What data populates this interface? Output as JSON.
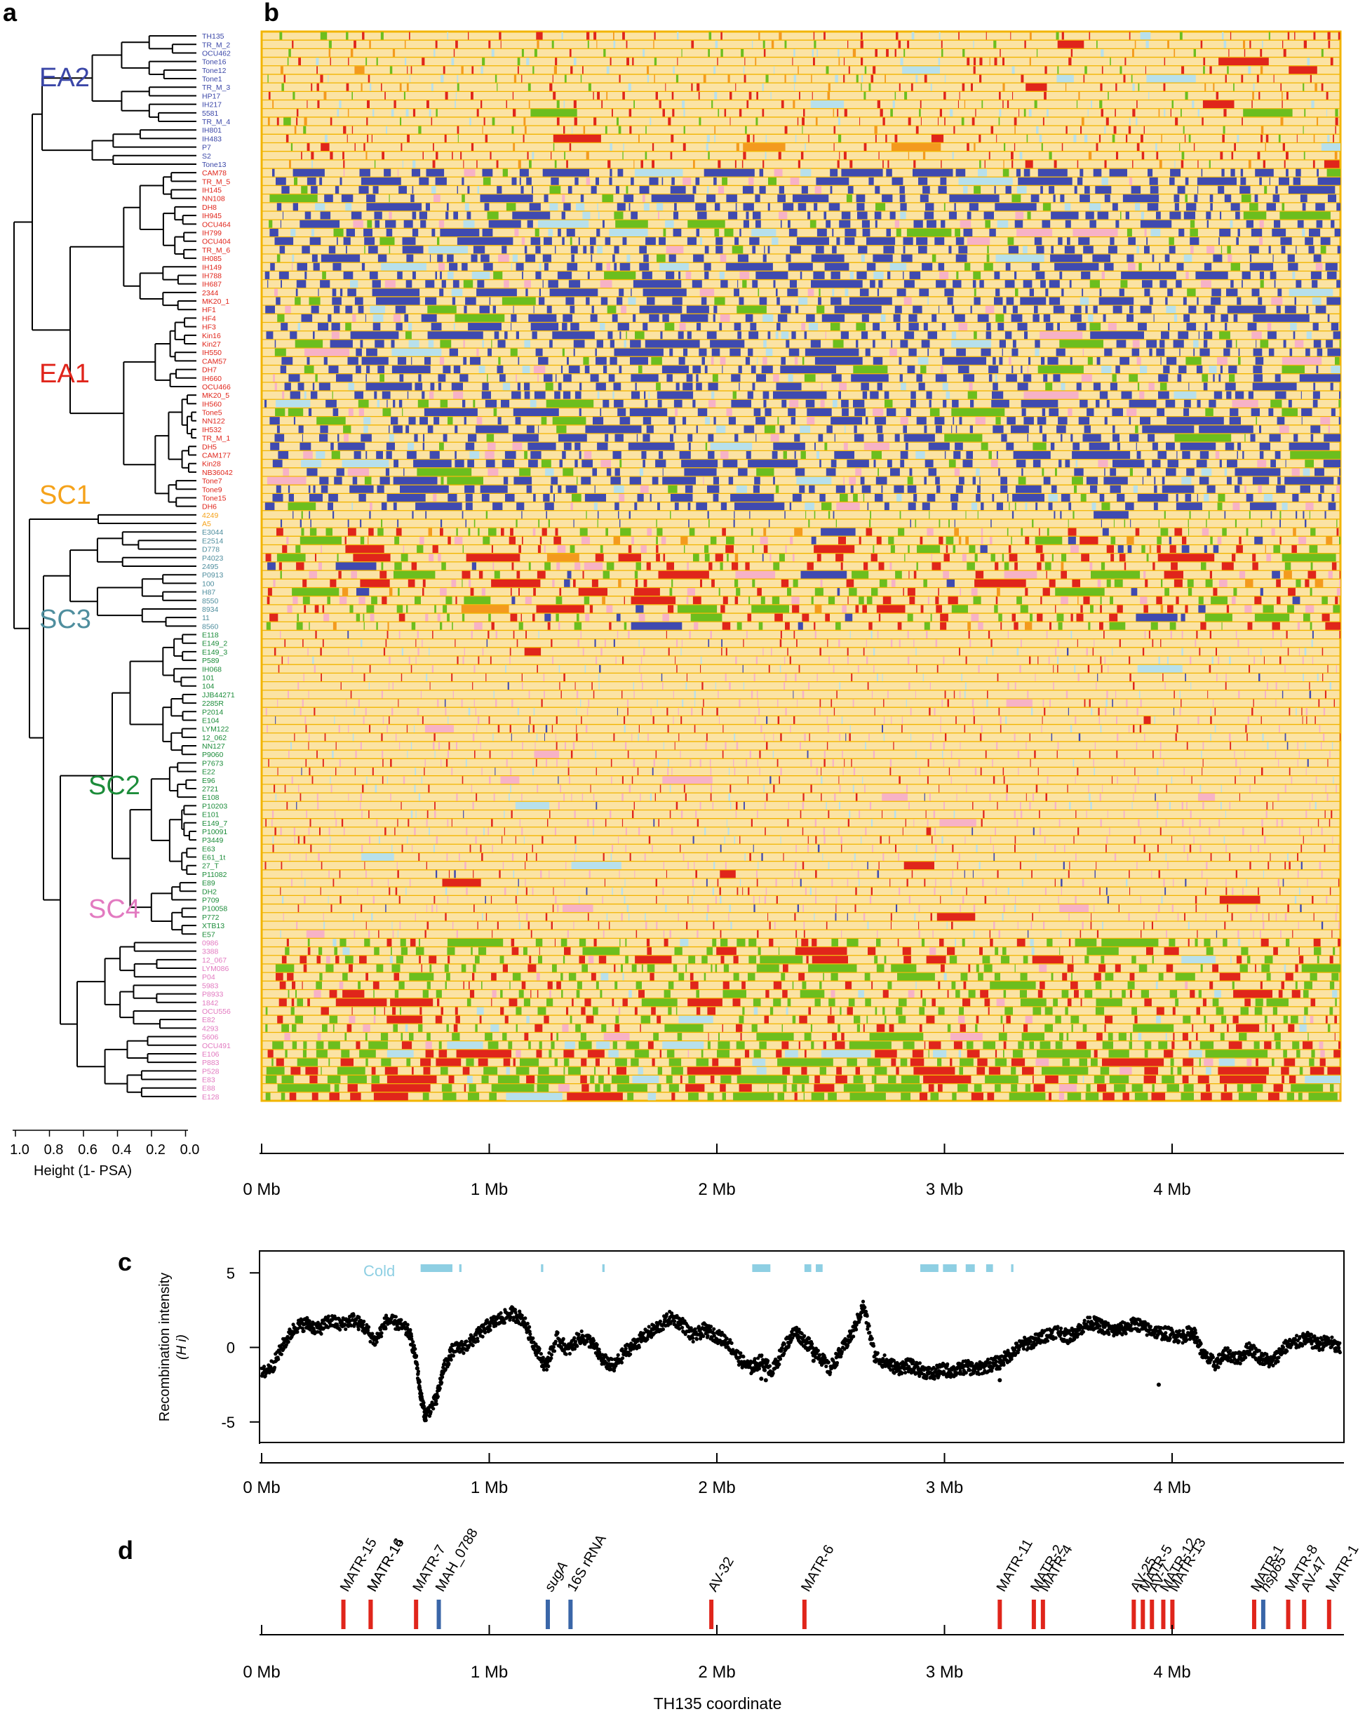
{
  "panels": {
    "a": {
      "letter": "a"
    },
    "b": {
      "letter": "b"
    },
    "c": {
      "letter": "c"
    },
    "d": {
      "letter": "d"
    }
  },
  "colors": {
    "EA2": "#3b47a8",
    "EA1": "#e0251b",
    "SC1": "#f5a21a",
    "SC3": "#4f8e9e",
    "SC2": "#1c8c3a",
    "SC4": "#e27ac0",
    "background": "#fbe3a4",
    "row_line": "#f2b400",
    "block_blue": "#3f4ab0",
    "block_red": "#e0251b",
    "block_green": "#6cbe1e",
    "block_pink": "#f7b2c6",
    "block_lightblue": "#b7e0ec",
    "block_orange": "#f39a1e",
    "cold": "#8ecfe3",
    "gene_red": "#e0251b",
    "gene_blue": "#3a66a8"
  },
  "clades": [
    {
      "name": "EA2",
      "color": "#3b47a8",
      "samples": [
        "TH135",
        "TR_M_2",
        "OCU462",
        "Tone16",
        "Tone12",
        "Tone1",
        "TR_M_3",
        "HP17",
        "IH217",
        "5581",
        "TR_M_4",
        "IH801",
        "IH483",
        "P7",
        "S2",
        "Tone13"
      ]
    },
    {
      "name": "EA1",
      "color": "#e0251b",
      "samples": [
        "CAM78",
        "TR_M_5",
        "IH145",
        "NN108",
        "DH8",
        "IH945",
        "OCU464",
        "IH799",
        "OCU404",
        "TR_M_6",
        "IH085",
        "IH149",
        "IH788",
        "IH687",
        "2344",
        "MK20_1",
        "HF1",
        "HF4",
        "HF3",
        "Kin16",
        "Kin27",
        "IH550",
        "CAM57",
        "DH7",
        "IH660",
        "OCU466",
        "MK20_5",
        "IH560",
        "Tone5",
        "NN122",
        "IH532",
        "TR_M_1",
        "DH5",
        "CAM177",
        "Kin28",
        "NB36042",
        "Tone7",
        "Tone9",
        "Tone15",
        "DH6"
      ]
    },
    {
      "name": "SC1",
      "color": "#f5a21a",
      "samples": [
        "4249",
        "A5"
      ]
    },
    {
      "name": "SC3",
      "color": "#4f8e9e",
      "samples": [
        "E3044",
        "E2514",
        "D778",
        "P4023",
        "2495",
        "P0913",
        "100",
        "H87",
        "8550",
        "8934",
        "11",
        "8560"
      ]
    },
    {
      "name": "SC2",
      "color": "#1c8c3a",
      "samples": [
        "E118",
        "E149_2",
        "E149_3",
        "P589",
        "IH068",
        "101",
        "104",
        "JJB44271",
        "2285R",
        "P2014",
        "E104",
        "LYM122",
        "12_062",
        "NN127",
        "P9060",
        "P7673",
        "E22",
        "E96",
        "2721",
        "E108",
        "P10203",
        "E101",
        "E149_7",
        "P10091",
        "P3449",
        "E63",
        "E61_1t",
        "27_T",
        "P11082",
        "E89",
        "DH2",
        "P709",
        "P10058",
        "P772",
        "XTB13",
        "E57"
      ]
    },
    {
      "name": "SC4",
      "color": "#e27ac0",
      "samples": [
        "0986",
        "3388",
        "12_067",
        "LYM086",
        "P04",
        "5983",
        "P8933",
        "1842",
        "OCU556",
        "E82",
        "4293",
        "5606",
        "OCU491",
        "E106",
        "P883",
        "P528",
        "E83",
        "E88",
        "E128"
      ]
    }
  ],
  "dendro_axis": {
    "ticks": [
      "1.0",
      "0.8",
      "0.6",
      "0.4",
      "0.2",
      "0.0"
    ],
    "label": "Height (1- PSA)"
  },
  "coord_axis": {
    "ticks": [
      "0 Mb",
      "1 Mb",
      "2 Mb",
      "3 Mb",
      "4 Mb"
    ],
    "xlabel": "TH135 coordinate"
  },
  "chart_data": [
    {
      "type": "heatmap",
      "panel": "b",
      "description_of_values": "haplotype block ancestry per sample along the genome",
      "x_range_mb": [
        0,
        4.75
      ],
      "rows": 125,
      "row_order": "same as dendrogram tip order in panel a"
    },
    {
      "type": "scatter",
      "panel": "c",
      "ylabel": "Recombination intensity",
      "ylabel_sub": "(H i)",
      "xlim_mb": [
        0,
        4.75
      ],
      "ylim": [
        -6,
        6
      ],
      "yticks": [
        "5",
        "0",
        "-5"
      ],
      "cold_label": "Cold",
      "cold_regions_mb": [
        [
          0.7,
          0.84
        ],
        [
          0.87,
          0.88
        ],
        [
          1.23,
          1.24
        ],
        [
          1.5,
          1.51
        ],
        [
          2.16,
          2.24
        ],
        [
          2.39,
          2.42
        ],
        [
          2.44,
          2.47
        ],
        [
          2.9,
          2.98
        ],
        [
          3.0,
          3.06
        ],
        [
          3.1,
          3.14
        ],
        [
          3.19,
          3.22
        ],
        [
          3.3,
          3.31
        ]
      ],
      "trend_mb": [
        [
          0.0,
          -1.8
        ],
        [
          0.05,
          -1.2
        ],
        [
          0.1,
          0.3
        ],
        [
          0.15,
          1.4
        ],
        [
          0.2,
          1.6
        ],
        [
          0.25,
          1.2
        ],
        [
          0.3,
          1.8
        ],
        [
          0.35,
          1.5
        ],
        [
          0.4,
          1.9
        ],
        [
          0.45,
          1.4
        ],
        [
          0.5,
          0.4
        ],
        [
          0.55,
          1.8
        ],
        [
          0.6,
          1.6
        ],
        [
          0.65,
          1.0
        ],
        [
          0.68,
          -0.8
        ],
        [
          0.7,
          -3.2
        ],
        [
          0.72,
          -4.6
        ],
        [
          0.77,
          -3.5
        ],
        [
          0.8,
          -1.5
        ],
        [
          0.84,
          -0.2
        ],
        [
          0.9,
          0.1
        ],
        [
          0.95,
          0.8
        ],
        [
          1.0,
          1.5
        ],
        [
          1.05,
          1.9
        ],
        [
          1.1,
          2.3
        ],
        [
          1.15,
          1.9
        ],
        [
          1.2,
          0.2
        ],
        [
          1.25,
          -1.3
        ],
        [
          1.3,
          0.6
        ],
        [
          1.35,
          -0.2
        ],
        [
          1.4,
          0.7
        ],
        [
          1.45,
          0.4
        ],
        [
          1.5,
          -0.8
        ],
        [
          1.55,
          -1.3
        ],
        [
          1.6,
          -0.3
        ],
        [
          1.65,
          0.3
        ],
        [
          1.7,
          0.9
        ],
        [
          1.75,
          1.4
        ],
        [
          1.8,
          2.0
        ],
        [
          1.85,
          1.6
        ],
        [
          1.9,
          0.7
        ],
        [
          1.95,
          1.2
        ],
        [
          2.0,
          0.8
        ],
        [
          2.05,
          0.4
        ],
        [
          2.1,
          -0.7
        ],
        [
          2.15,
          -1.4
        ],
        [
          2.2,
          -0.9
        ],
        [
          2.25,
          -1.6
        ],
        [
          2.3,
          0.0
        ],
        [
          2.35,
          1.1
        ],
        [
          2.4,
          0.3
        ],
        [
          2.45,
          -0.4
        ],
        [
          2.5,
          -1.5
        ],
        [
          2.55,
          -0.3
        ],
        [
          2.6,
          0.9
        ],
        [
          2.65,
          2.8
        ],
        [
          2.7,
          -0.6
        ],
        [
          2.75,
          -1.0
        ],
        [
          2.8,
          -1.4
        ],
        [
          2.85,
          -1.2
        ],
        [
          2.9,
          -1.5
        ],
        [
          2.95,
          -1.8
        ],
        [
          3.0,
          -1.5
        ],
        [
          3.05,
          -1.6
        ],
        [
          3.1,
          -1.3
        ],
        [
          3.15,
          -1.5
        ],
        [
          3.2,
          -1.2
        ],
        [
          3.25,
          -1.0
        ],
        [
          3.3,
          -0.4
        ],
        [
          3.35,
          0.2
        ],
        [
          3.4,
          0.4
        ],
        [
          3.45,
          0.8
        ],
        [
          3.5,
          1.1
        ],
        [
          3.55,
          0.7
        ],
        [
          3.6,
          1.2
        ],
        [
          3.65,
          1.7
        ],
        [
          3.7,
          1.4
        ],
        [
          3.75,
          1.1
        ],
        [
          3.8,
          1.3
        ],
        [
          3.85,
          1.6
        ],
        [
          3.9,
          1.2
        ],
        [
          3.95,
          1.0
        ],
        [
          4.0,
          0.9
        ],
        [
          4.05,
          0.7
        ],
        [
          4.1,
          1.1
        ],
        [
          4.15,
          -0.6
        ],
        [
          4.2,
          -1.1
        ],
        [
          4.25,
          -0.4
        ],
        [
          4.3,
          -0.8
        ],
        [
          4.35,
          0.0
        ],
        [
          4.4,
          -0.7
        ],
        [
          4.45,
          -1.0
        ],
        [
          4.5,
          0.0
        ],
        [
          4.55,
          0.3
        ],
        [
          4.6,
          0.6
        ],
        [
          4.65,
          0.2
        ],
        [
          4.7,
          0.4
        ],
        [
          4.75,
          -0.2
        ]
      ],
      "outliers_mb": [
        [
          2.2,
          -2.1
        ],
        [
          2.22,
          -2.2
        ],
        [
          3.25,
          -2.2
        ],
        [
          3.95,
          -2.5
        ],
        [
          2.43,
          -0.9
        ],
        [
          2.98,
          -1.9
        ]
      ]
    },
    {
      "type": "table",
      "panel": "d",
      "markers": [
        {
          "name": "MATR-15",
          "pos_mb": 0.36,
          "color": "red"
        },
        {
          "name": "MATR-16",
          "pos_mb": 0.48,
          "color": "red"
        },
        {
          "name": "MATR-14",
          "pos_mb": 0.48,
          "color": "red"
        },
        {
          "name": "MATR-7",
          "pos_mb": 0.68,
          "color": "red"
        },
        {
          "name": "MAH_0788",
          "pos_mb": 0.78,
          "color": "blue"
        },
        {
          "name": "sugA",
          "pos_mb": 1.26,
          "color": "blue",
          "italic": true
        },
        {
          "name": "16S rRNA",
          "pos_mb": 1.36,
          "color": "blue"
        },
        {
          "name": "AV-32",
          "pos_mb": 1.98,
          "color": "red"
        },
        {
          "name": "MATR-6",
          "pos_mb": 2.39,
          "color": "red"
        },
        {
          "name": "MATR-11",
          "pos_mb": 3.25,
          "color": "red"
        },
        {
          "name": "MATR-2",
          "pos_mb": 3.4,
          "color": "red"
        },
        {
          "name": "MATR-4",
          "pos_mb": 3.44,
          "color": "red"
        },
        {
          "name": "AV-25",
          "pos_mb": 3.84,
          "color": "red"
        },
        {
          "name": "MATR-5",
          "pos_mb": 3.88,
          "color": "red"
        },
        {
          "name": "AV-7",
          "pos_mb": 3.92,
          "color": "red"
        },
        {
          "name": "MATR-12",
          "pos_mb": 3.97,
          "color": "red"
        },
        {
          "name": "MATR-13",
          "pos_mb": 4.01,
          "color": "red"
        },
        {
          "name": "MATR-1",
          "pos_mb": 4.37,
          "color": "red"
        },
        {
          "name": "hsp65",
          "pos_mb": 4.41,
          "color": "blue",
          "italic": true
        },
        {
          "name": "MATR-8",
          "pos_mb": 4.52,
          "color": "red"
        },
        {
          "name": "AV-47",
          "pos_mb": 4.59,
          "color": "red"
        },
        {
          "name": "MATR-1",
          "pos_mb": 4.7,
          "color": "red"
        }
      ]
    }
  ]
}
